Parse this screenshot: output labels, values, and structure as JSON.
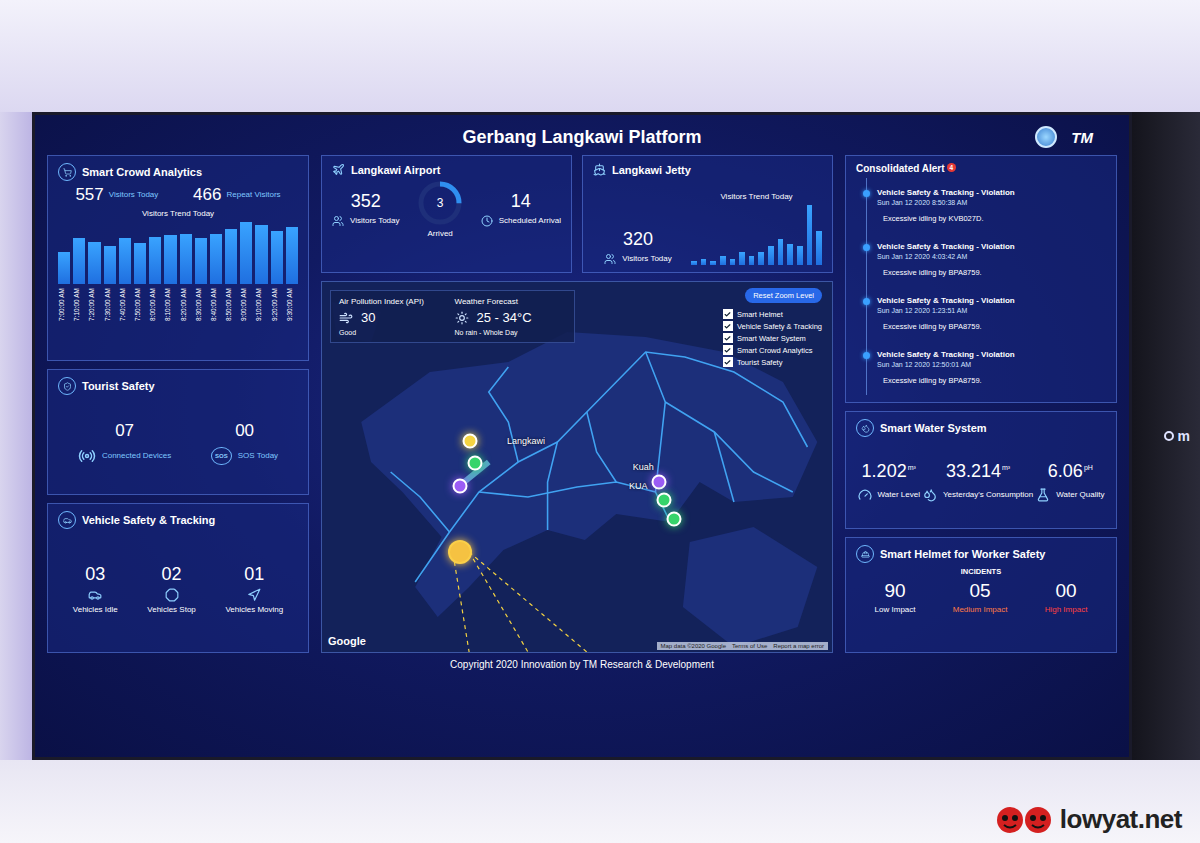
{
  "screen": {
    "title": "Gerbang Langkawi Platform",
    "logo": "TM",
    "copyright": "Copyright 2020 Innovation by TM Research & Development"
  },
  "crowd": {
    "title": "Smart Crowd Analytics",
    "stats": [
      {
        "value": "557",
        "label": "Visitors Today"
      },
      {
        "value": "466",
        "label": "Repeat Visitors"
      }
    ],
    "chart": {
      "title": "Visitors Trend Today",
      "labels": [
        "7:00:00 AM",
        "7:10:00 AM",
        "7:20:00 AM",
        "7:30:00 AM",
        "7:40:00 AM",
        "7:50:00 AM",
        "8:00:00 AM",
        "8:10:00 AM",
        "8:20:00 AM",
        "8:30:00 AM",
        "8:40:00 AM",
        "8:50:00 AM",
        "9:00:00 AM",
        "9:10:00 AM",
        "9:20:00 AM",
        "9:30:00 AM"
      ],
      "values": [
        28,
        40,
        37,
        33,
        40,
        36,
        41,
        43,
        44,
        40,
        44,
        48,
        55,
        52,
        47,
        50
      ]
    }
  },
  "tourist": {
    "title": "Tourist Safety",
    "sos_icon": "SOS",
    "stats": [
      {
        "value": "07",
        "label": "Connected Devices"
      },
      {
        "value": "00",
        "label": "SOS Today"
      }
    ]
  },
  "vehicle": {
    "title": "Vehicle Safety & Tracking",
    "stats": [
      {
        "value": "03",
        "label": "Vehicles Idle"
      },
      {
        "value": "02",
        "label": "Vehicles Stop"
      },
      {
        "value": "01",
        "label": "Vehicles Moving"
      }
    ]
  },
  "airport": {
    "title": "Langkawi Airport",
    "visitors": {
      "value": "352",
      "label": "Visitors Today"
    },
    "ring": {
      "value": "3",
      "label": "Arrived",
      "level": 0.25
    },
    "scheduled": {
      "value": "14",
      "label": "Scheduled Arrival"
    }
  },
  "jetty": {
    "title": "Langkawi Jetty",
    "visitors": {
      "value": "320",
      "label": "Visitors Today"
    },
    "chart": {
      "title": "Visitors Trend Today",
      "values": [
        2,
        3,
        2,
        4,
        3,
        6,
        4,
        6,
        9,
        12,
        10,
        9,
        28,
        16
      ]
    }
  },
  "environment": {
    "api": {
      "title": "Air Pollution Index (API)",
      "value": "30",
      "status": "Good"
    },
    "weather": {
      "title": "Weather Forecast",
      "value": "25 - 34°C",
      "note": "No rain - Whole Day"
    }
  },
  "map": {
    "reset": "Reset Zoom Level",
    "layers": [
      {
        "label": "Smart Helmet",
        "checked": true
      },
      {
        "label": "Vehicle Safety & Tracking",
        "checked": true
      },
      {
        "label": "Smart Water System",
        "checked": true
      },
      {
        "label": "Smart Crowd Analytics",
        "checked": true
      },
      {
        "label": "Tourist Safety",
        "checked": true
      }
    ],
    "places": [
      {
        "name": "Langkawi"
      },
      {
        "name": "Kuah"
      },
      {
        "name": "KUA"
      }
    ],
    "pins": [
      {
        "kind": "marker",
        "color": "#f5d442"
      },
      {
        "kind": "marker",
        "color": "#36d46b"
      },
      {
        "kind": "marker",
        "color": "#9c5cf5"
      },
      {
        "kind": "cluster",
        "color": "#f5c242"
      },
      {
        "kind": "marker",
        "color": "#9c5cf5"
      },
      {
        "kind": "marker",
        "color": "#36d46b"
      },
      {
        "kind": "marker",
        "color": "#36d46b"
      }
    ],
    "attribution": "Google",
    "footer": [
      "Map data ©2020 Google",
      "Terms of Use",
      "Report a map error"
    ]
  },
  "alerts": {
    "title": "Consolidated Alert",
    "badge": "4",
    "items": [
      {
        "title": "Vehicle Safety & Tracking - Violation",
        "time": "Sun Jan 12 2020 8:50:38 AM",
        "message": "Excessive idling by KVB027D."
      },
      {
        "title": "Vehicle Safety & Tracking - Violation",
        "time": "Sun Jan 12 2020 4:03:42 AM",
        "message": "Excessive idling by BPA8759."
      },
      {
        "title": "Vehicle Safety & Tracking - Violation",
        "time": "Sun Jan 12 2020 1:23:51 AM",
        "message": "Excessive idling by BPA8759."
      },
      {
        "title": "Vehicle Safety & Tracking - Violation",
        "time": "Sun Jan 12 2020 12:50:01 AM",
        "message": "Excessive idling by BPA8759."
      }
    ]
  },
  "water": {
    "title": "Smart Water System",
    "stats": [
      {
        "value": "1.202",
        "unit": "m³",
        "label": "Water Level"
      },
      {
        "value": "33.214",
        "unit": "m³",
        "label": "Yesterday's Consumption"
      },
      {
        "value": "6.06",
        "unit": "pH",
        "label": "Water Quality"
      }
    ]
  },
  "helmet": {
    "title": "Smart Helmet for Worker Safety",
    "caption": "INCIDENTS",
    "stats": [
      {
        "value": "90",
        "label": "Low Impact",
        "color": "#ffffff"
      },
      {
        "value": "05",
        "label": "Medium Impact",
        "color": "#ff7a45"
      },
      {
        "value": "00",
        "label": "High Impact",
        "color": "#ff4040"
      }
    ]
  },
  "side_screen": {
    "text": "m"
  },
  "watermark": {
    "text": "lowyat.net"
  }
}
